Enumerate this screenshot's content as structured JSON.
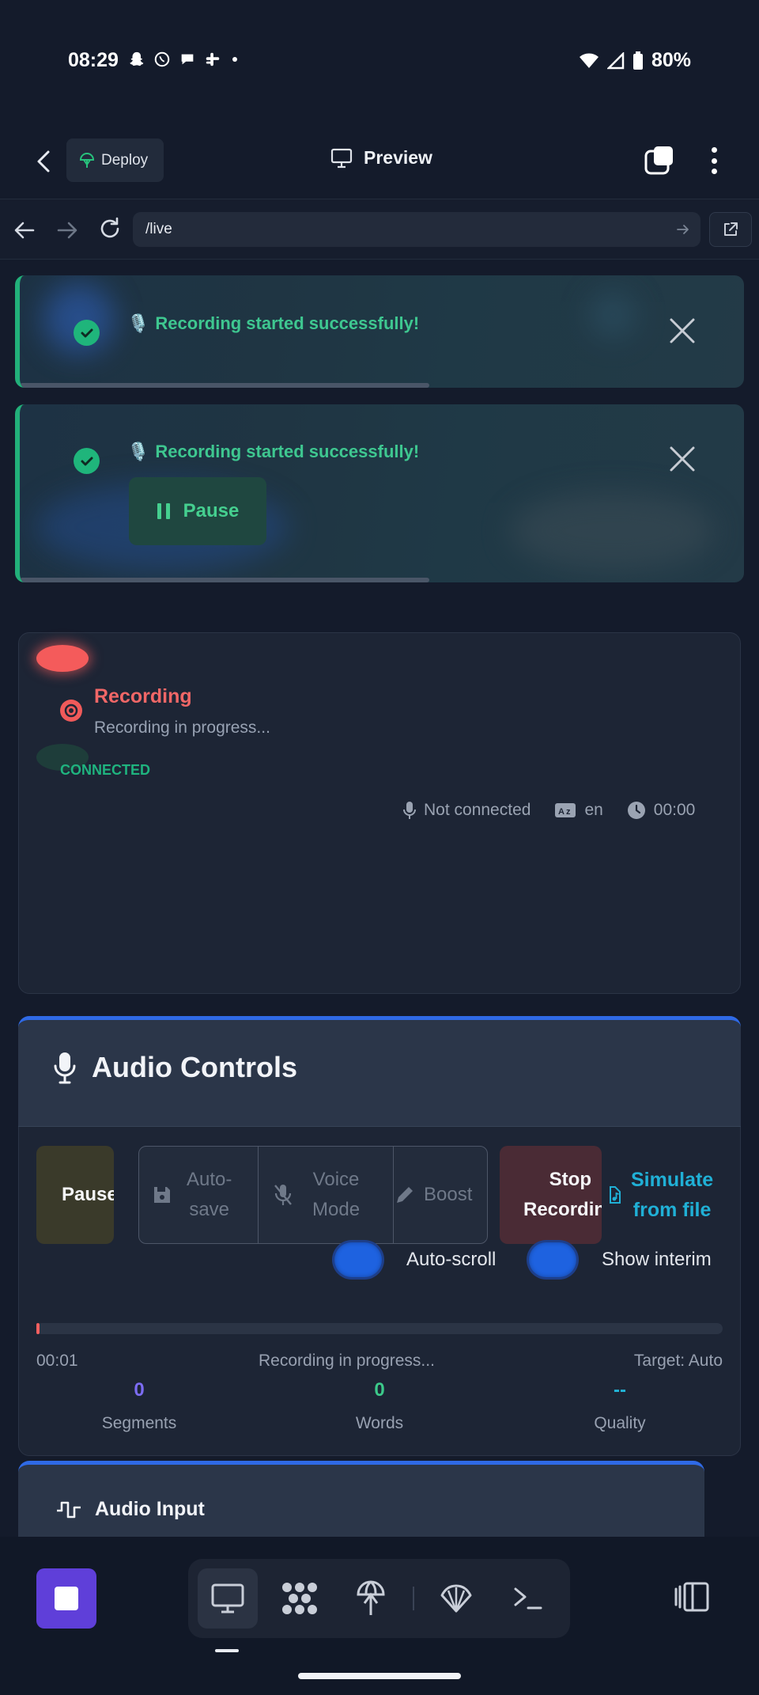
{
  "status_bar": {
    "time": "08:29",
    "battery": "80%"
  },
  "header": {
    "deploy_label": "Deploy",
    "title": "Preview"
  },
  "url_bar": {
    "url": "/live"
  },
  "toasts": [
    {
      "message": "Recording started successfully!",
      "emoji": "🎙️"
    },
    {
      "message": "Recording started successfully!",
      "emoji": "🎙️",
      "action_label": "Pause"
    }
  ],
  "recording": {
    "title": "Recording",
    "subtitle": "Recording in progress...",
    "connection": "CONNECTED",
    "mic_status": "Not connected",
    "language": "en",
    "timer": "00:00"
  },
  "audio_controls": {
    "title": "Audio Controls",
    "pause_label": "Pause",
    "autosave_line1": "Auto-",
    "autosave_line2": "save",
    "voicemode_line1": "Voice",
    "voicemode_line2": "Mode",
    "boost_label": "Boost",
    "stop_line1": "Stop",
    "stop_line2": "Recording",
    "simulate_line1": "Simulate",
    "simulate_line2": "from file",
    "autoscroll_label": "Auto-scroll",
    "show_interim_label": "Show interim",
    "progress_fraction": 0.005,
    "elapsed": "00:01",
    "status": "Recording in progress...",
    "target": "Target: Auto",
    "stats": [
      {
        "value": "0",
        "label": "Segments",
        "color": "#7c6cf2"
      },
      {
        "value": "0",
        "label": "Words",
        "color": "#3cc98a"
      },
      {
        "value": "--",
        "label": "Quality",
        "color": "#22b6d8"
      }
    ]
  },
  "audio_input": {
    "title": "Audio Input"
  },
  "colors": {
    "accent": "#2f6ae6",
    "success": "#22b07a",
    "danger": "#f25f5f",
    "stop_button": "#5f3fd9"
  }
}
